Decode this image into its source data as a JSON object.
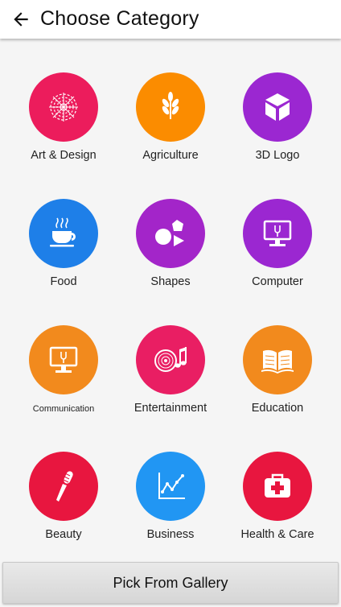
{
  "header": {
    "title": "Choose Category",
    "back_icon": "arrow-left-icon"
  },
  "categories": [
    {
      "label": "Art & Design",
      "color": "#ec1c5c",
      "icon": "spiral-pattern-icon"
    },
    {
      "label": "Agriculture",
      "color": "#fb8c00",
      "icon": "wheat-icon"
    },
    {
      "label": "3D Logo",
      "color": "#9b27d1",
      "icon": "cube-icon"
    },
    {
      "label": "Food",
      "color": "#1e7fe8",
      "icon": "coffee-cup-icon"
    },
    {
      "label": "Shapes",
      "color": "#a325c9",
      "icon": "shapes-icon"
    },
    {
      "label": "Computer",
      "color": "#9b27d1",
      "icon": "monitor-icon"
    },
    {
      "label": "Communication",
      "color": "#f28a1d",
      "icon": "monitor-icon"
    },
    {
      "label": "Entertainment",
      "color": "#e91e63",
      "icon": "music-disc-icon"
    },
    {
      "label": "Education",
      "color": "#f28a1d",
      "icon": "open-book-icon"
    },
    {
      "label": "Beauty",
      "color": "#e8163f",
      "icon": "brush-icon"
    },
    {
      "label": "Business",
      "color": "#2196f3",
      "icon": "growth-chart-icon"
    },
    {
      "label": "Health & Care",
      "color": "#e8163f",
      "icon": "first-aid-kit-icon"
    }
  ],
  "footer": {
    "button_label": "Pick From Gallery"
  }
}
